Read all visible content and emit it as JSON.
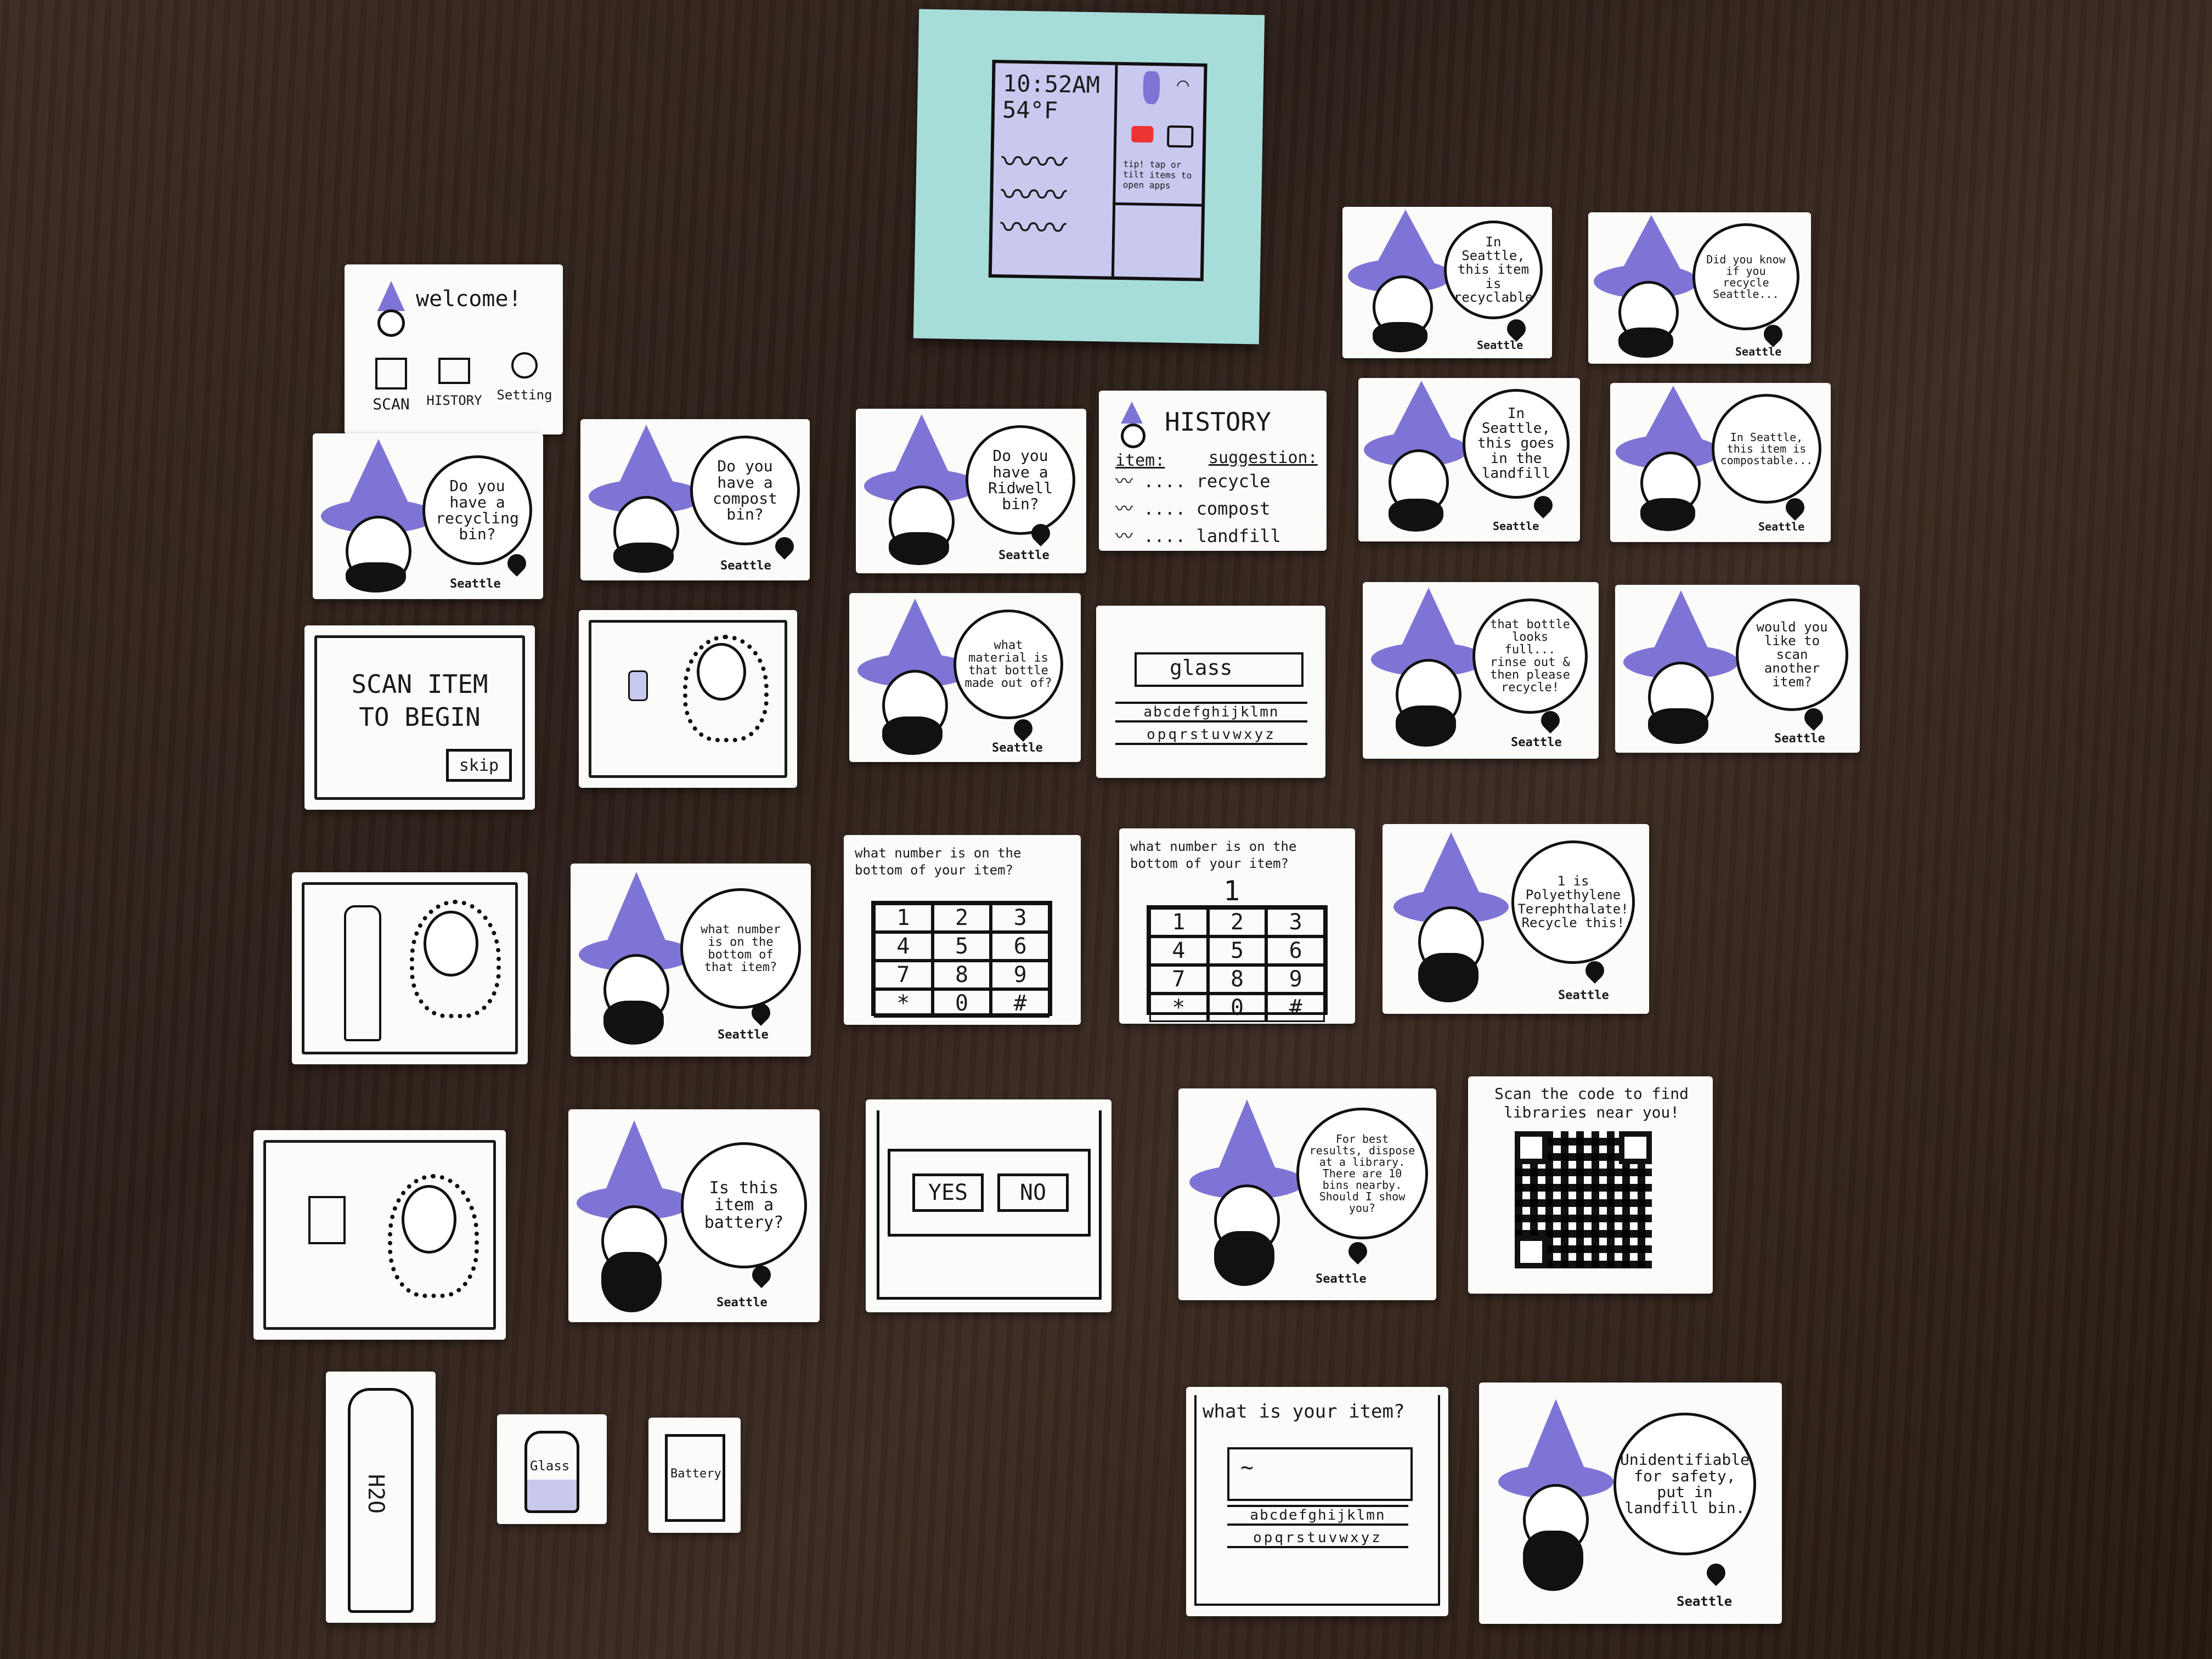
{
  "device": {
    "time": "10:52AM",
    "temperature": "54°F",
    "tip": "tip! tap or tilt items to open apps"
  },
  "cards": {
    "welcome": {
      "title": "welcome!",
      "scan": "SCAN",
      "history": "HISTORY",
      "setting": "Setting"
    },
    "scan_begin": {
      "line1": "SCAN ITEM",
      "line2": "TO BEGIN",
      "skip": "skip"
    },
    "history": {
      "title": "HISTORY",
      "col_item": "item:",
      "col_suggestion": "suggestion:",
      "row1": "recycle",
      "row2": "compost",
      "row3": "landfill"
    },
    "glass_input": {
      "value": "glass",
      "keys1": "abcdefghijklmn",
      "keys2": "opqrstuvwxyz"
    },
    "number_q": "what number is on the bottom of your item?",
    "keypad": [
      "1",
      "2",
      "3",
      "4",
      "5",
      "6",
      "7",
      "8",
      "9",
      "*",
      "0",
      "#"
    ],
    "keypad_entered": "1",
    "yes": "YES",
    "no": "NO",
    "qr_text": "Scan the code to find libraries near you!",
    "what_item": {
      "title": "what is your item?",
      "value": "~",
      "keys1": "abcdefghijklmn",
      "keys2": "opqrstuvwxyz"
    },
    "bubbles": {
      "recycling_bin": "Do you have a recycling bin?",
      "compost_bin": "Do you have a compost bin?",
      "ridwell_bin": "Do you have a Ridwell bin?",
      "bottle_material": "what material is that bottle made out of?",
      "number_bottom": "what number is on the bottom of that item?",
      "battery": "Is this item a battery?",
      "recyclable": "In Seattle, this item is recyclable",
      "did_you_know": "Did you know if you recycle Seattle...",
      "landfill": "In Seattle, this goes in the landfill",
      "compostable": "In Seattle, this item is compostable...",
      "rinse": "that bottle looks full... rinse out & then please recycle!",
      "scan_another": "would you like to scan another item?",
      "polyethylene": "1 is Polyethylene Terephthalate! Recycle this!",
      "library": "For best results, dispose at a library. There are 10 bins nearby. Should I show you?",
      "unidentifiable": "Unidentifiable for safety, put in landfill bin."
    },
    "city": "Seattle",
    "props": {
      "bottle": "H2O",
      "jar": "Glass",
      "battery": "Battery"
    }
  },
  "colors": {
    "table": "#2b1e18",
    "card": "#fbfbf9",
    "hat": "#7e74d6",
    "device": "#a7ddd8",
    "screen": "#c9c8ef"
  }
}
